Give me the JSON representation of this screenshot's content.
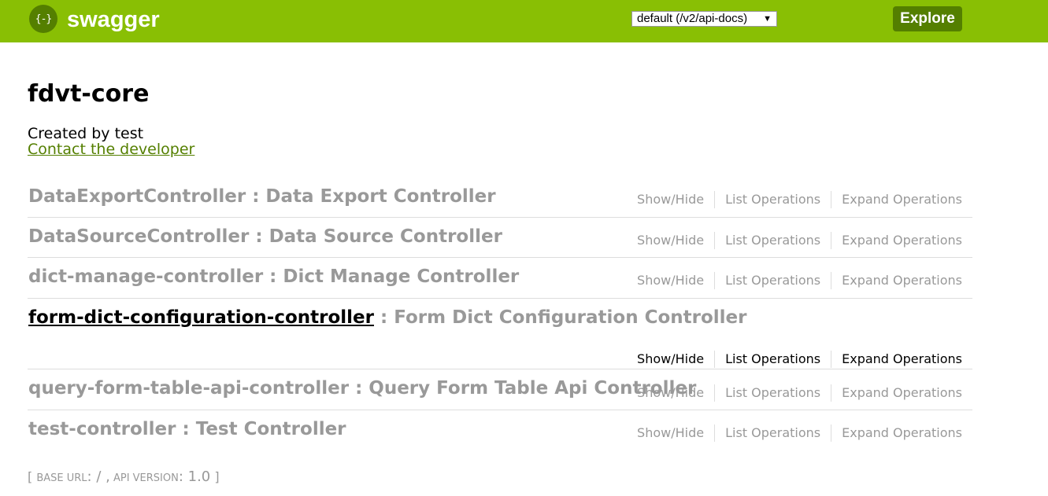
{
  "header": {
    "logo_glyph": "{-}",
    "logo_text": "swagger",
    "spec_select": "default (/v2/api-docs)",
    "explore_label": "Explore"
  },
  "info": {
    "title": "fdvt-core",
    "created_by": "Created by test",
    "contact_link": "Contact the developer"
  },
  "resources": [
    {
      "name": "DataExportController",
      "desc": " : Data Export Controller"
    },
    {
      "name": "DataSourceController",
      "desc": " : Data Source Controller"
    },
    {
      "name": "dict-manage-controller",
      "desc": " : Dict Manage Controller"
    },
    {
      "name": "form-dict-configuration-controller",
      "desc": " : Form Dict Configuration Controller"
    },
    {
      "name": "query-form-table-api-controller",
      "desc": " : Query Form Table Api Controller"
    },
    {
      "name": "test-controller",
      "desc": " : Test Controller"
    }
  ],
  "ops_labels": {
    "show_hide": "Show/Hide",
    "list_operations": "List Operations",
    "expand_operations": "Expand Operations"
  },
  "footer": {
    "open_bracket": "[ ",
    "base_url_label": "BASE URL",
    "base_url_value": ": / ,",
    "api_version_label": " API VERSION",
    "api_version_value": ": 1.0",
    "close_bracket": " ]"
  },
  "colors": {
    "header_bg": "#89bf04",
    "accent_dark": "#547f00",
    "muted_text": "#999999"
  }
}
